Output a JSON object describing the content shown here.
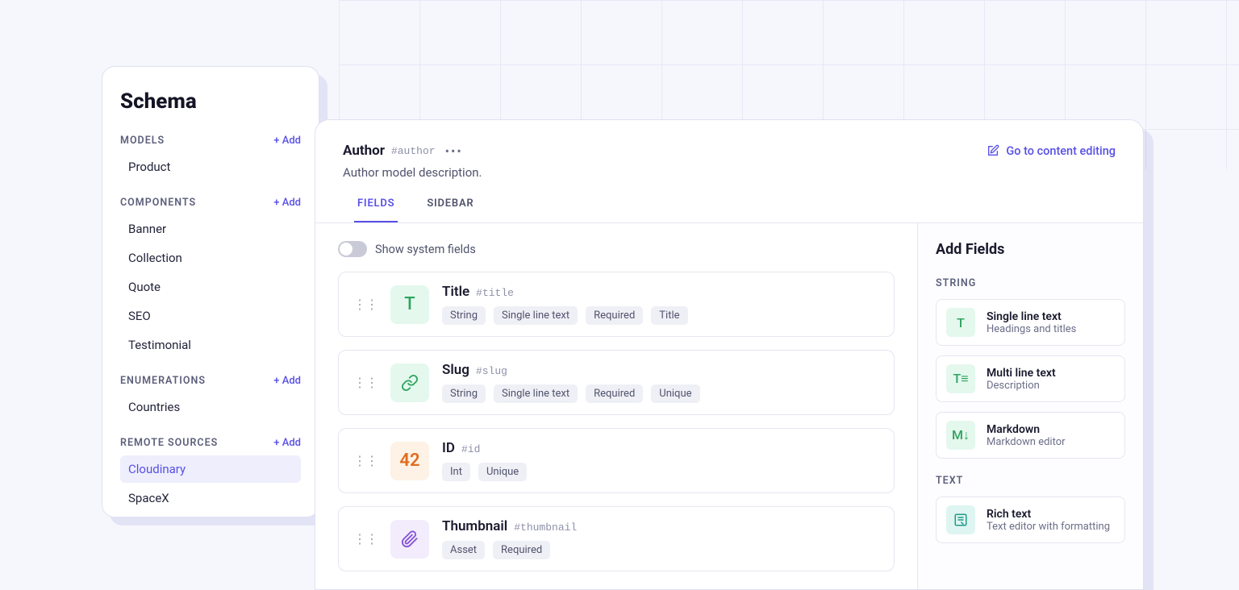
{
  "sidebar": {
    "title": "Schema",
    "addLabel": "+ Add",
    "sections": [
      {
        "label": "MODELS",
        "items": [
          "Product"
        ]
      },
      {
        "label": "COMPONENTS",
        "items": [
          "Banner",
          "Collection",
          "Quote",
          "SEO",
          "Testimonial"
        ]
      },
      {
        "label": "ENUMERATIONS",
        "items": [
          "Countries"
        ]
      },
      {
        "label": "REMOTE SOURCES",
        "items": [
          "Cloudinary",
          "SpaceX"
        ],
        "activeIndex": 0
      }
    ]
  },
  "model": {
    "title": "Author",
    "id": "#author",
    "description": "Author model description.",
    "goLink": "Go to content editing"
  },
  "tabs": [
    {
      "label": "FIELDS",
      "active": true
    },
    {
      "label": "SIDEBAR",
      "active": false
    }
  ],
  "showSystemFields": {
    "label": "Show system fields",
    "on": false
  },
  "fields": [
    {
      "icon": "T",
      "iconClass": "icon-green",
      "kind": "text",
      "title": "Title",
      "id": "#title",
      "tags": [
        "String",
        "Single line text",
        "Required",
        "Title"
      ]
    },
    {
      "icon": "link",
      "iconClass": "icon-green",
      "kind": "link",
      "title": "Slug",
      "id": "#slug",
      "tags": [
        "String",
        "Single line text",
        "Required",
        "Unique"
      ]
    },
    {
      "icon": "42",
      "iconClass": "icon-orange",
      "kind": "text",
      "title": "ID",
      "id": "#id",
      "tags": [
        "Int",
        "Unique"
      ]
    },
    {
      "icon": "clip",
      "iconClass": "icon-purple",
      "kind": "clip",
      "title": "Thumbnail",
      "id": "#thumbnail",
      "tags": [
        "Asset",
        "Required"
      ]
    }
  ],
  "addFields": {
    "title": "Add Fields",
    "groups": [
      {
        "label": "STRING",
        "types": [
          {
            "icon": "T",
            "iconClass": "icon-green",
            "kind": "text",
            "title": "Single line text",
            "desc": "Headings and titles"
          },
          {
            "icon": "T≡",
            "iconClass": "icon-green",
            "kind": "text",
            "title": "Multi line text",
            "desc": "Description"
          },
          {
            "icon": "M↓",
            "iconClass": "icon-green",
            "kind": "text",
            "title": "Markdown",
            "desc": "Markdown editor"
          }
        ]
      },
      {
        "label": "TEXT",
        "types": [
          {
            "icon": "rich",
            "iconClass": "icon-teal",
            "kind": "rich",
            "title": "Rich text",
            "desc": "Text editor with formatting"
          }
        ]
      }
    ]
  }
}
